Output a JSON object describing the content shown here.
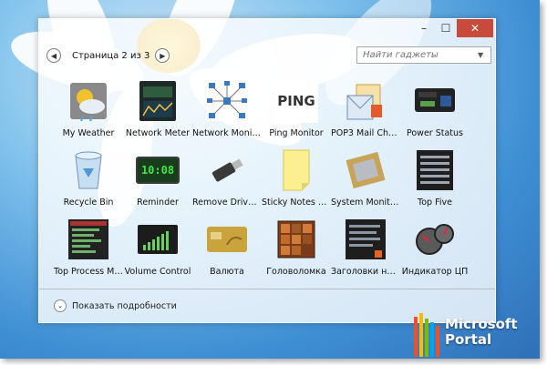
{
  "window": {
    "controls": {
      "minimize": "–",
      "maximize": "☐",
      "close": "✕"
    },
    "pager": {
      "prev": "◀",
      "text": "Страница 2 из 3",
      "next": "▶"
    },
    "search": {
      "placeholder": "Найти гаджеты",
      "dropdown": "▼"
    },
    "details_label": "Показать подробности",
    "details_icon": "⌄"
  },
  "gadgets": [
    {
      "label": "My Weather",
      "icon": "weather-icon"
    },
    {
      "label": "Network Meter",
      "icon": "network-meter-icon"
    },
    {
      "label": "Network Monit...",
      "icon": "network-monitor-icon"
    },
    {
      "label": "Ping Monitor",
      "icon": "ping-icon",
      "text": "PING"
    },
    {
      "label": "POP3 Mail Chec...",
      "icon": "mail-icon"
    },
    {
      "label": "Power Status",
      "icon": "power-status-icon"
    },
    {
      "label": "Recycle Bin",
      "icon": "recycle-bin-icon"
    },
    {
      "label": "Reminder",
      "icon": "reminder-clock-icon",
      "text": "10:08"
    },
    {
      "label": "Remove Drive S...",
      "icon": "usb-drive-icon"
    },
    {
      "label": "Sticky Notes On...",
      "icon": "sticky-note-icon"
    },
    {
      "label": "System Monitor II",
      "icon": "cpu-chip-icon"
    },
    {
      "label": "Top Five",
      "icon": "top-five-icon"
    },
    {
      "label": "Top Process Mo...",
      "icon": "top-process-icon"
    },
    {
      "label": "Volume Control",
      "icon": "volume-icon"
    },
    {
      "label": "Валюта",
      "icon": "currency-card-icon"
    },
    {
      "label": "Головоломка",
      "icon": "puzzle-icon"
    },
    {
      "label": "Заголовки нов...",
      "icon": "news-headlines-icon"
    },
    {
      "label": "Индикатор ЦП",
      "icon": "cpu-gauge-icon"
    }
  ],
  "watermark": {
    "line1": "Microsoft",
    "line2": "Portal"
  }
}
